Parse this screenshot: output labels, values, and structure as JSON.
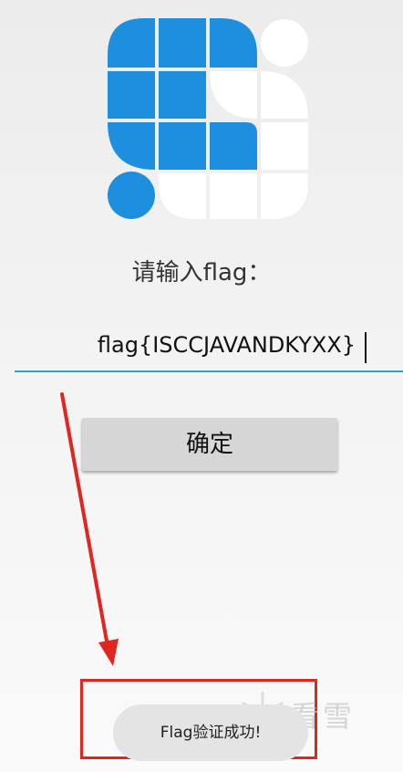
{
  "logo": {
    "name": "isccc-logo",
    "blue": "#1e8fdf",
    "white": "#ffffff"
  },
  "form": {
    "prompt": "请输入flag：",
    "flag_value": "flag{ISCCJAVANDKYXX}",
    "confirm_label": "确定",
    "underline_color": "#29a5c9"
  },
  "toast": {
    "message": "Flag验证成功!"
  },
  "annotation": {
    "color": "#e0261f"
  },
  "watermark": {
    "text": "看雪"
  }
}
